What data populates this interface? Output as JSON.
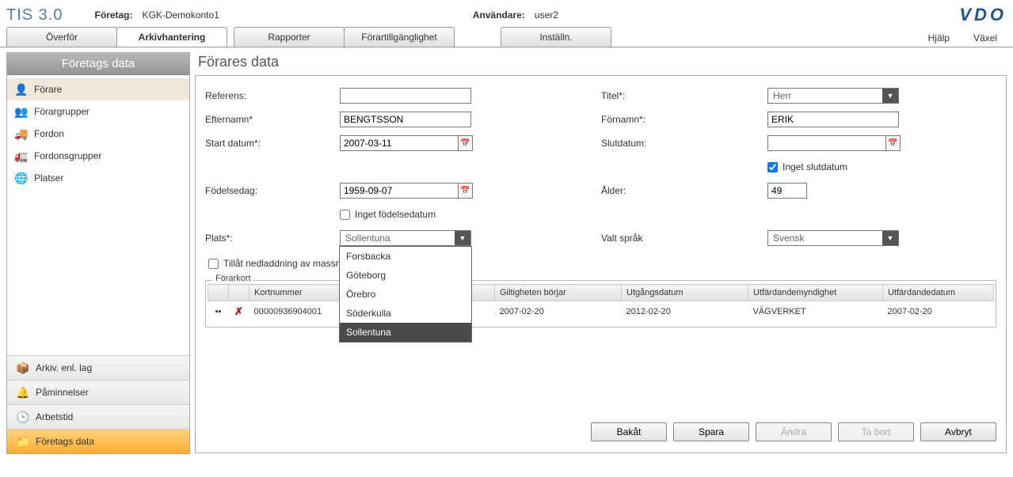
{
  "app": {
    "title": "TIS 3.0"
  },
  "header": {
    "company_label": "Företag:",
    "company_value": "KGK-Demokonto1",
    "user_label": "Användare:",
    "user_value": "user2",
    "logo": "VDO"
  },
  "menu": {
    "tabs": [
      {
        "label": "Överför"
      },
      {
        "label": "Arkivhantering",
        "active": true
      },
      {
        "label": "Rapporter"
      },
      {
        "label": "Förartillgänglighet"
      },
      {
        "label": "Inställn."
      }
    ],
    "help": "Hjälp",
    "switch": "Växel"
  },
  "sidebar": {
    "title": "Företags data",
    "items": [
      {
        "label": "Förare",
        "icon": "👤",
        "active": true
      },
      {
        "label": "Förargrupper",
        "icon": "👥"
      },
      {
        "label": "Fordon",
        "icon": "🚚"
      },
      {
        "label": "Fordonsgrupper",
        "icon": "🚛"
      },
      {
        "label": "Platser",
        "icon": "🌐"
      }
    ],
    "bottom": [
      {
        "label": "Arkiv. enl. lag",
        "icon": "📦"
      },
      {
        "label": "Påminnelser",
        "icon": "🔔"
      },
      {
        "label": "Arbetstid",
        "icon": "🕒"
      },
      {
        "label": "Företags data",
        "icon": "📁",
        "active": true
      }
    ]
  },
  "content": {
    "title": "Förares data",
    "labels": {
      "reference": "Referens:",
      "title": "Titel*:",
      "lastname": "Efternamn*",
      "firstname": "Förnamn*:",
      "startdate": "Start datum*:",
      "enddate": "Slutdatum:",
      "no_enddate": "Inget slutdatum",
      "birthday": "Födelsedag:",
      "age": "Ålder:",
      "no_birthdate": "Inget födelsedatum",
      "place": "Plats*:",
      "language": "Valt språk",
      "allow_download": "Tillåt nedladdning av massn",
      "driver_card": "Förarkort"
    },
    "values": {
      "reference": "",
      "title_selected": "Herr",
      "lastname": "BENGTSSON",
      "firstname": "ERIK",
      "startdate": "2007-03-11",
      "enddate": "",
      "no_enddate_checked": true,
      "birthday": "1959-09-07",
      "no_birthdate_checked": false,
      "age": "49",
      "place_selected": "Sollentuna",
      "language_selected": "Svensk",
      "allow_download_checked": false
    },
    "place_options": [
      "Forsbacka",
      "Göteborg",
      "Örebro",
      "Söderkulla",
      "Sollentuna"
    ],
    "table": {
      "headers": {
        "card_number": "Kortnummer",
        "valid_from": "Giltigheten börjar",
        "expiry": "Utgångsdatum",
        "authority": "Utfärdandemyndighet",
        "issue_date": "Utfärdandedatum"
      },
      "rows": [
        {
          "card_number": "00000936904001",
          "valid_from": "2007-02-20",
          "expiry": "2012-02-20",
          "authority": "VÄGVERKET",
          "issue_date": "2007-02-20"
        }
      ]
    },
    "buttons": {
      "back": "Bakåt",
      "save": "Spara",
      "edit": "Ändra",
      "delete": "Ta bort",
      "cancel": "Avbryt"
    }
  }
}
